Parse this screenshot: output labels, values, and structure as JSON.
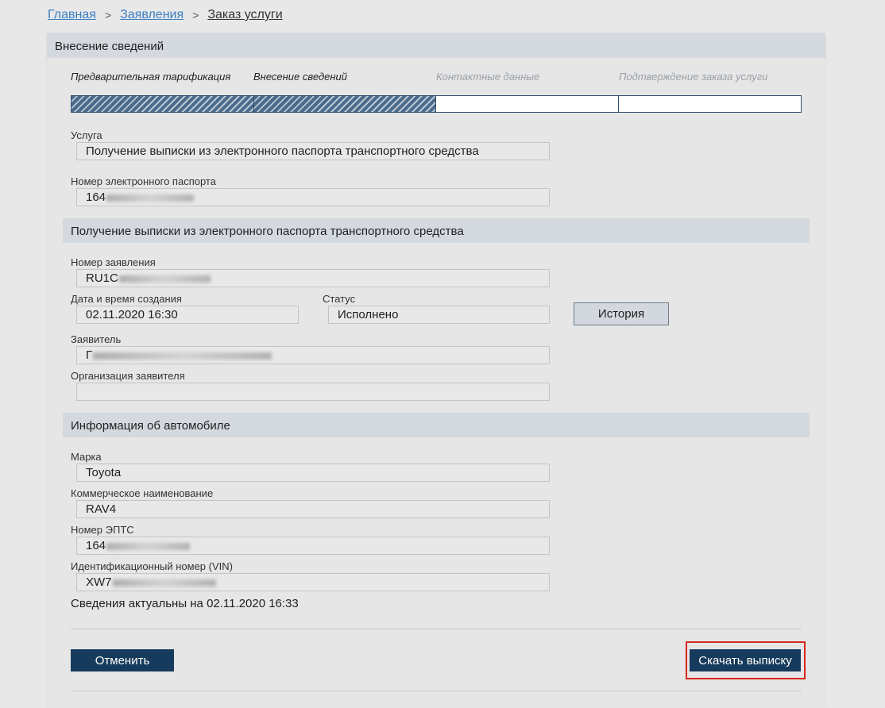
{
  "breadcrumb": {
    "home": "Главная",
    "applications": "Заявления",
    "current": "Заказ услуги"
  },
  "panel": {
    "title": "Внесение сведений"
  },
  "steps": [
    {
      "label": "Предварительная тарификация",
      "state": "done"
    },
    {
      "label": "Внесение сведений",
      "state": "done"
    },
    {
      "label": "Контактные данные",
      "state": "todo"
    },
    {
      "label": "Подтверждение заказа услуги",
      "state": "todo"
    }
  ],
  "service": {
    "label": "Услуга",
    "value": "Получение выписки из электронного паспорта транспортного средства"
  },
  "passport": {
    "label": "Номер электронного паспорта",
    "value": "164"
  },
  "section1": {
    "title": "Получение выписки из электронного паспорта транспортного средства"
  },
  "application": {
    "number_label": "Номер заявления",
    "number_value": "RU1C",
    "created_label": "Дата и время создания",
    "created_value": "02.11.2020 16:30",
    "status_label": "Статус",
    "status_value": "Исполнено",
    "history_button": "История",
    "applicant_label": "Заявитель",
    "applicant_value": "Г",
    "org_label": "Организация заявителя",
    "org_value": ""
  },
  "section2": {
    "title": "Информация об автомобиле"
  },
  "car": {
    "brand_label": "Марка",
    "brand_value": "Toyota",
    "model_label": "Коммерческое наименование",
    "model_value": "RAV4",
    "epts_label": "Номер ЭПТС",
    "epts_value": "164",
    "vin_label": "Идентификационный номер (VIN)",
    "vin_value": "XW7"
  },
  "note": "Сведения актуальны на 02.11.2020 16:33",
  "actions": {
    "cancel": "Отменить",
    "download": "Скачать выписку"
  },
  "colors": {
    "primary": "#173b5c",
    "highlight": "#d9261c",
    "link": "#3a7fc4"
  }
}
